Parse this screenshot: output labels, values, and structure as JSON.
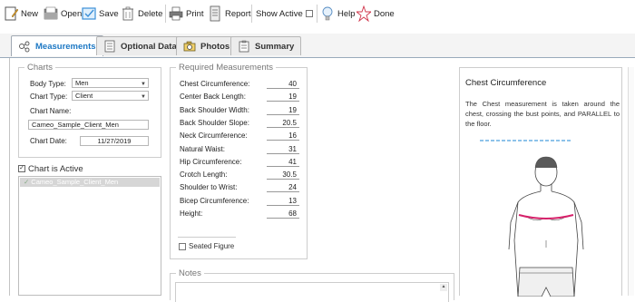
{
  "toolbar": {
    "new": "New",
    "open": "Open",
    "save": "Save",
    "delete": "Delete",
    "print": "Print",
    "report": "Report",
    "show_active": "Show Active",
    "help": "Help",
    "done": "Done"
  },
  "tabs": [
    {
      "label": "Measurements",
      "active": true
    },
    {
      "label": "Optional Data",
      "active": false
    },
    {
      "label": "Photos",
      "active": false
    },
    {
      "label": "Summary",
      "active": false
    }
  ],
  "charts": {
    "title": "Charts",
    "body_type_label": "Body Type:",
    "body_type_value": "Men",
    "chart_type_label": "Chart Type:",
    "chart_type_value": "Client",
    "chart_name_label": "Chart Name:",
    "chart_name_value": "Cameo_Sample_Client_Men",
    "chart_date_label": "Chart Date:",
    "chart_date_value": "11/27/2019",
    "chart_active_label": "Chart is Active",
    "chart_active_checked": true,
    "list_items": [
      "Cameo_Sample_Client_Men"
    ]
  },
  "required": {
    "title": "Required Measurements",
    "rows": [
      {
        "label": "Chest Circumference:",
        "value": "40"
      },
      {
        "label": "Center Back Length:",
        "value": "19"
      },
      {
        "label": "Back Shoulder Width:",
        "value": "19"
      },
      {
        "label": "Back Shoulder Slope:",
        "value": "20.5"
      },
      {
        "label": "Neck Circumference:",
        "value": "16"
      },
      {
        "label": "Natural Waist:",
        "value": "31"
      },
      {
        "label": "Hip Circumference:",
        "value": "41"
      },
      {
        "label": "Crotch Length:",
        "value": "30.5"
      },
      {
        "label": "Shoulder to Wrist:",
        "value": "24"
      },
      {
        "label": "Bicep Circumference:",
        "value": "13"
      },
      {
        "label": "Height:",
        "value": "68"
      }
    ],
    "seated_figure_label": "Seated Figure"
  },
  "notes": {
    "title": "Notes"
  },
  "info": {
    "title": "Chest Circumference",
    "description": "The Chest measurement is taken around the chest, crossing the bust points, and PARALLEL to the floor."
  },
  "colors": {
    "accent": "#1d78c4",
    "measure_line": "#d6226a",
    "dashed_line": "#8ec3ea"
  }
}
